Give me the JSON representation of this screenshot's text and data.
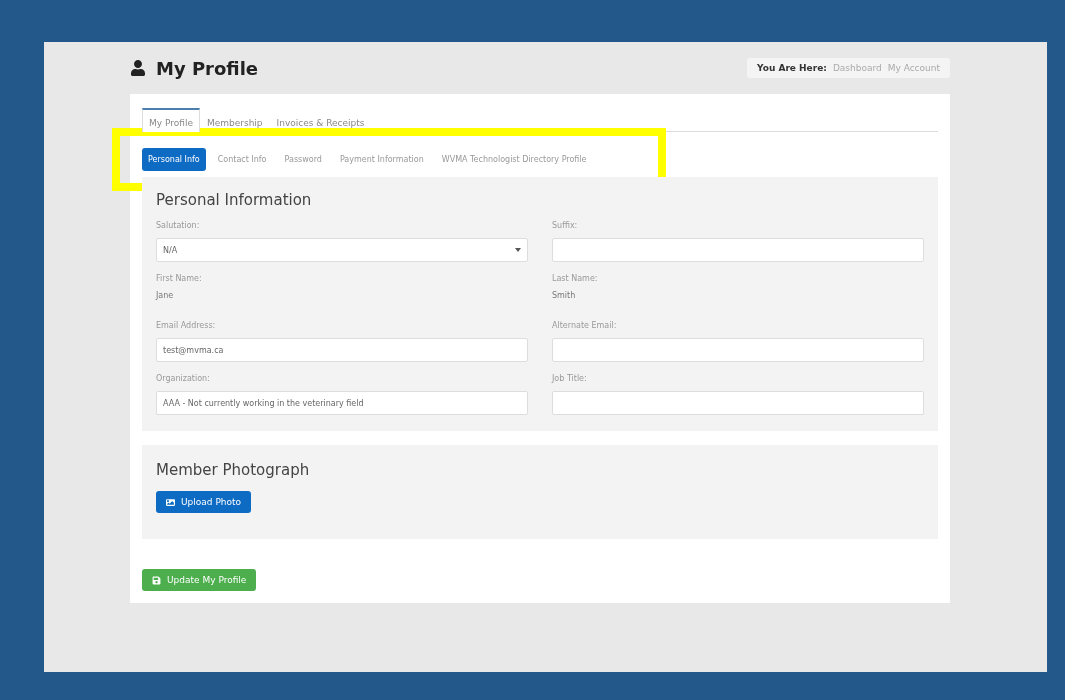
{
  "page": {
    "title": "My Profile"
  },
  "breadcrumb": {
    "label": "You Are Here:",
    "items": [
      "Dashboard",
      "My Account"
    ]
  },
  "tabs": [
    {
      "label": "My Profile",
      "selected": true
    },
    {
      "label": "Membership",
      "selected": false
    },
    {
      "label": "Invoices & Receipts",
      "selected": false
    }
  ],
  "subtabs": [
    {
      "label": "Personal Info",
      "selected": true
    },
    {
      "label": "Contact Info",
      "selected": false
    },
    {
      "label": "Password",
      "selected": false
    },
    {
      "label": "Payment Information",
      "selected": false
    },
    {
      "label": "WVMA Technologist Directory Profile",
      "selected": false
    }
  ],
  "personal_information": {
    "title": "Personal Information",
    "fields": [
      {
        "kind": "select",
        "label": "Salutation:",
        "value": "N/A"
      },
      {
        "kind": "input",
        "label": "Suffix:"
      },
      {
        "kind": "static",
        "label": "First Name:",
        "value": "Jane"
      },
      {
        "kind": "static",
        "label": "Last Name:",
        "value": "Smith"
      },
      {
        "kind": "input",
        "label": "Email Address:",
        "value": "test@mvma.ca"
      },
      {
        "kind": "input",
        "label": "Alternate Email:"
      },
      {
        "kind": "input",
        "label": "Organization:",
        "value": "AAA - Not currently working in the veterinary field"
      },
      {
        "kind": "input",
        "label": "Job Title:"
      }
    ]
  },
  "member_photograph": {
    "title": "Member Photograph",
    "button": "Upload Photo"
  },
  "submit_button": "Update My Profile"
}
